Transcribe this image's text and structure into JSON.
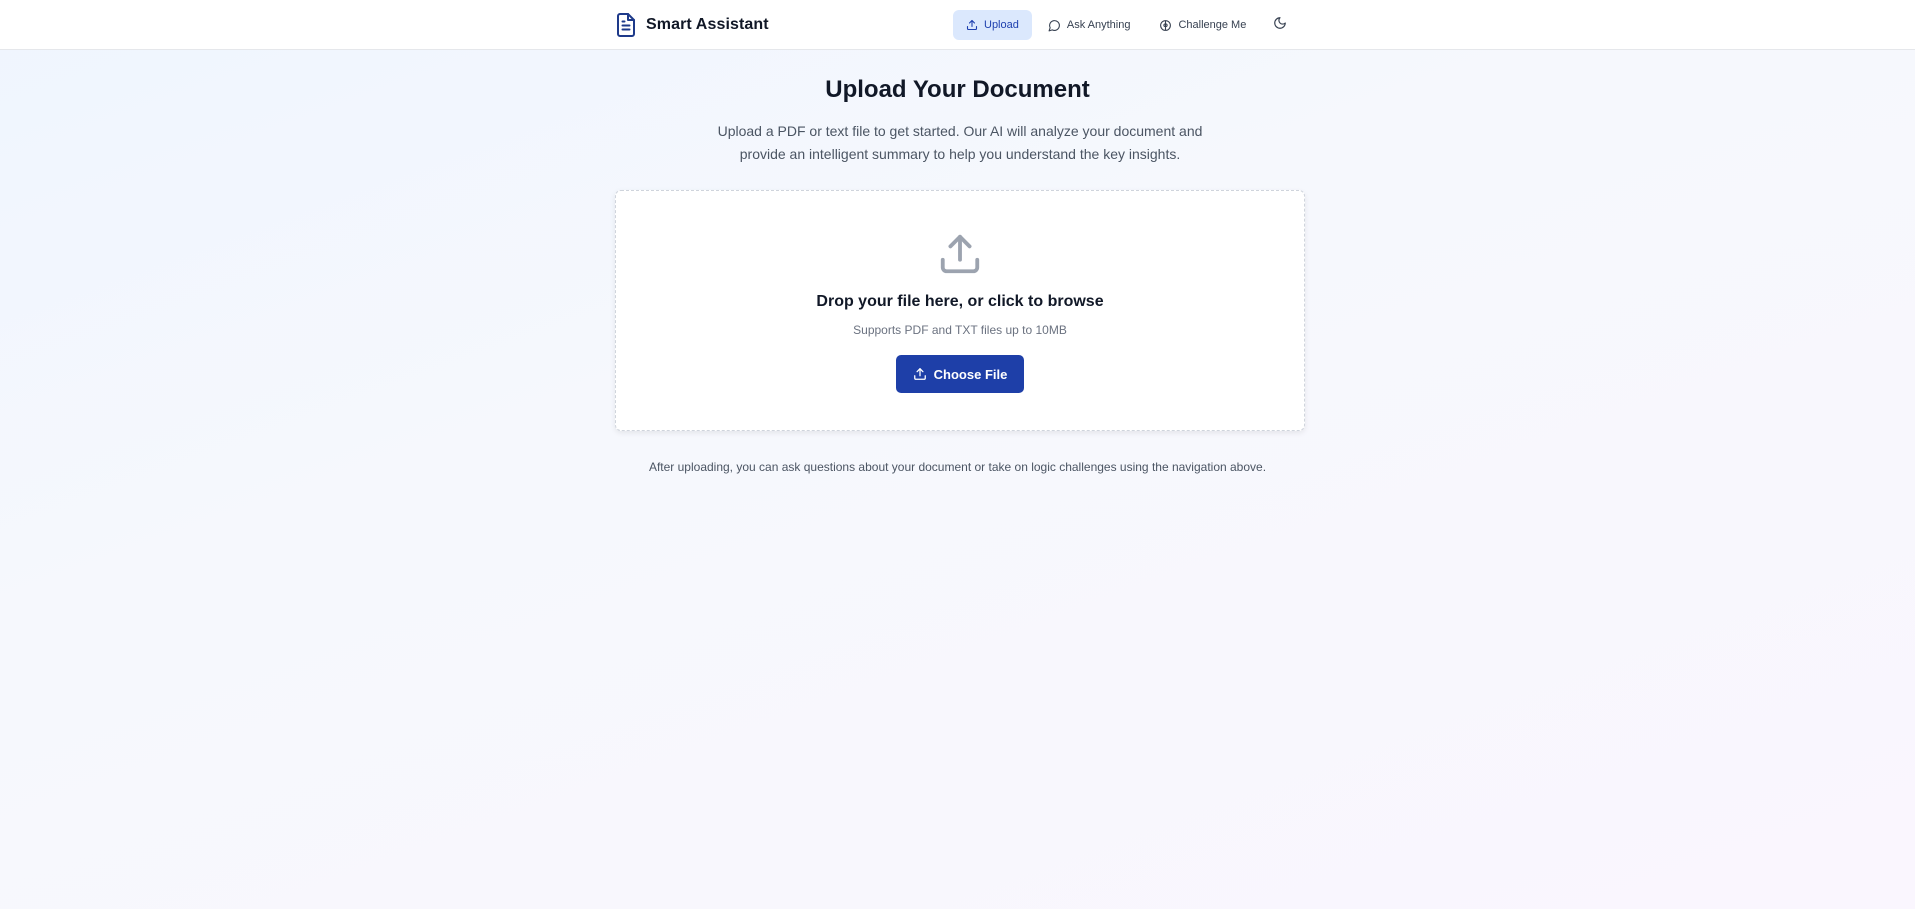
{
  "header": {
    "brand_icon": "file-text-icon",
    "brand_title": "Smart Assistant",
    "nav": [
      {
        "label": "Upload",
        "icon": "upload-icon",
        "active": true
      },
      {
        "label": "Ask Anything",
        "icon": "message-circle-icon",
        "active": false
      },
      {
        "label": "Challenge Me",
        "icon": "brain-icon",
        "active": false
      }
    ],
    "theme_toggle_icon": "moon-icon"
  },
  "main": {
    "title": "Upload Your Document",
    "intro": "Upload a PDF or text file to get started. Our AI will analyze your document and provide an intelligent summary to help you understand the key insights.",
    "dropzone": {
      "icon": "upload-icon",
      "prompt": "Drop your file here, or click to browse",
      "support": "Supports PDF and TXT files up to 10MB",
      "button_label": "Choose File"
    },
    "footer_note": "After uploading, you can ask questions about your document or take on logic challenges using the navigation above."
  },
  "colors": {
    "primary": "#1e3fa8",
    "brand_icon": "#1e3a8a",
    "active_nav_bg": "#dbe8fd",
    "active_nav_text": "#1e40af",
    "muted_icon": "#9ca3af"
  }
}
